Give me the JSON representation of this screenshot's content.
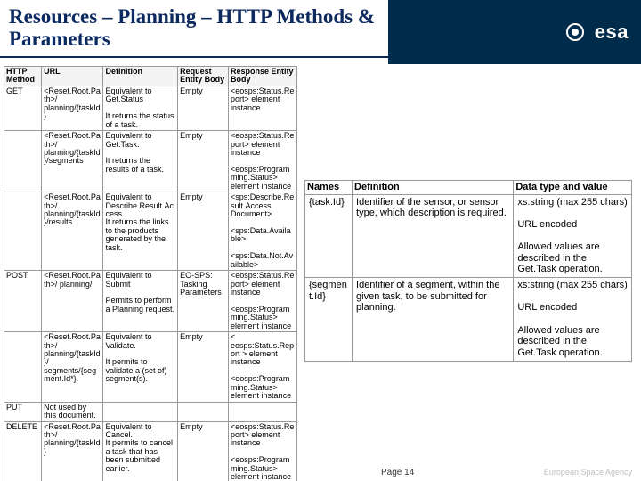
{
  "header": {
    "title": "Resources – Planning – HTTP Methods & Parameters",
    "logo_word": "esa",
    "agency": "European Space Agency"
  },
  "main_table": {
    "headers": [
      "HTTP Method",
      "URL",
      "Definition",
      "Request Entity Body",
      "Response Entity Body"
    ],
    "rows": [
      {
        "m": "GET",
        "u": "<Reset.Root.Path>/ planning/{taskId}",
        "d": "Equivalent to Get.Status\n\nIt returns the status of a task.",
        "req": "Empty",
        "res": "<eosps:Status.Report> element instance"
      },
      {
        "m": "",
        "u": "<Reset.Root.Path>/ planning/{taskId}/segments",
        "d": "Equivalent to Get.Task.\n\nIt returns the results of a task.",
        "req": "Empty",
        "res": "<eosps:Status.Report> element instance\n\n<eosps:Programming.Status> element instance"
      },
      {
        "m": "",
        "u": "<Reset.Root.Path>/ planning/{taskId}/results",
        "d": "Equivalent to Describe.Result.Access\nIt returns the links to the products generated by the task.",
        "req": "Empty",
        "res": "<sps:Describe.Result.Access Document>\n\n<sps:Data.Available>\n\n<sps:Data.Not.Available>"
      },
      {
        "m": "POST",
        "u": "<Reset.Root.Path>/ planning/",
        "d": "Equivalent to Submit\n\nPermits to perform a Planning request.",
        "req": "EO-SPS: Tasking Parameters",
        "res": "<eosps:Status.Report> element instance\n\n<eosps:Programming.Status> element instance"
      },
      {
        "m": "",
        "u": "<Reset.Root.Path>/ planning/{taskId}/ segments/{segment.Id*}.",
        "d": "Equivalent to Validate.\n\nIt permits to validate a (set of) segment(s).",
        "req": "Empty",
        "res": "< eosps:Status.Report > element instance\n\n<eosps:Programming.Status> element instance"
      },
      {
        "m": "PUT",
        "u": "Not used by this document.",
        "d": "",
        "req": "",
        "res": ""
      },
      {
        "m": "DELETE",
        "u": "<Reset.Root.Path>/ planning/{taskId}",
        "d": "Equivalent to Cancel.\nIt permits to cancel a task that has been submitted earlier.",
        "req": "Empty",
        "res": "<eosps:Status.Report> element instance\n\n<eosps:Programming.Status> element instance"
      }
    ]
  },
  "param_table": {
    "headers": [
      "Names",
      "Definition",
      "Data type and value"
    ],
    "rows": [
      {
        "n": "{task.Id}",
        "d": "Identifier of the sensor, or sensor type, which description is required.",
        "t": "xs:string (max 255 chars)\n\nURL encoded\n\nAllowed values are described in the Get.Task operation."
      },
      {
        "n": "{segment.Id}",
        "d": "Identifier of a segment, within the given task, to be submitted for planning.",
        "t": "xs:string (max 255 chars)\n\nURL encoded\n\nAllowed values are described in the Get.Task operation."
      }
    ]
  },
  "footer": {
    "page": "Page 14"
  }
}
